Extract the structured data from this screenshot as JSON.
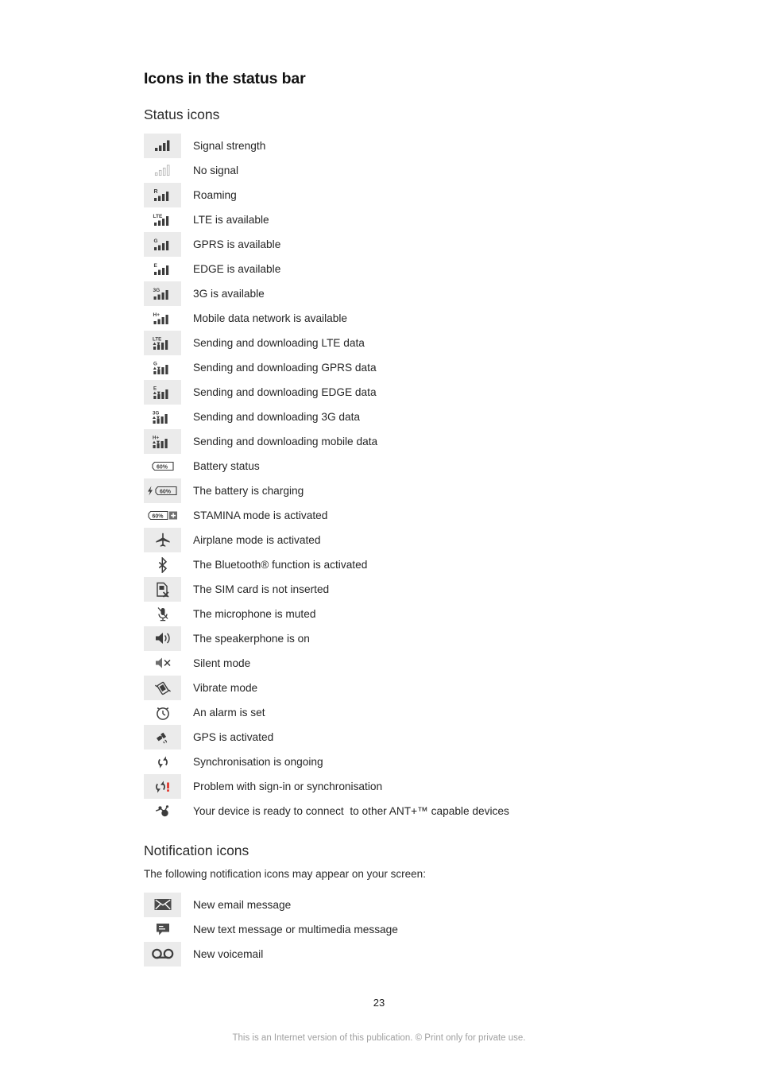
{
  "document": {
    "chapter_title": "Icons in the status bar",
    "page_number": "23",
    "footer_note": "This is an Internet version of this publication. © Print only for private use."
  },
  "status_section": {
    "heading": "Status icons",
    "rows": [
      {
        "icon": "signal-strength-icon",
        "label": "Signal strength"
      },
      {
        "icon": "no-signal-icon",
        "label": "No signal"
      },
      {
        "icon": "roaming-icon",
        "label": "Roaming"
      },
      {
        "icon": "lte-available-icon",
        "label": "LTE is available"
      },
      {
        "icon": "gprs-available-icon",
        "label": "GPRS is available"
      },
      {
        "icon": "edge-available-icon",
        "label": "EDGE is available"
      },
      {
        "icon": "3g-available-icon",
        "label": "3G is available"
      },
      {
        "icon": "mobile-data-available-icon",
        "label": "Mobile data network is available"
      },
      {
        "icon": "lte-data-transfer-icon",
        "label": "Sending and downloading LTE data"
      },
      {
        "icon": "gprs-data-transfer-icon",
        "label": "Sending and downloading GPRS data"
      },
      {
        "icon": "edge-data-transfer-icon",
        "label": "Sending and downloading EDGE data"
      },
      {
        "icon": "3g-data-transfer-icon",
        "label": "Sending and downloading 3G data"
      },
      {
        "icon": "mobile-data-transfer-icon",
        "label": "Sending and downloading mobile data"
      },
      {
        "icon": "battery-status-icon",
        "label": "Battery status"
      },
      {
        "icon": "battery-charging-icon",
        "label": "The battery is charging"
      },
      {
        "icon": "stamina-mode-icon",
        "label": "STAMINA mode is activated"
      },
      {
        "icon": "airplane-mode-icon",
        "label": "Airplane mode is activated"
      },
      {
        "icon": "bluetooth-icon",
        "label": "The Bluetooth® function is activated"
      },
      {
        "icon": "sim-card-missing-icon",
        "label": "The SIM card is not inserted"
      },
      {
        "icon": "microphone-muted-icon",
        "label": "The microphone is muted"
      },
      {
        "icon": "speakerphone-icon",
        "label": "The speakerphone is on"
      },
      {
        "icon": "silent-mode-icon",
        "label": "Silent mode"
      },
      {
        "icon": "vibrate-mode-icon",
        "label": "Vibrate mode"
      },
      {
        "icon": "alarm-icon",
        "label": "An alarm is set"
      },
      {
        "icon": "gps-icon",
        "label": "GPS is activated"
      },
      {
        "icon": "sync-ongoing-icon",
        "label": "Synchronisation is ongoing"
      },
      {
        "icon": "sync-problem-icon",
        "label": "Problem with sign-in or synchronisation"
      },
      {
        "icon": "ant-plus-icon",
        "label": "Your device is ready to connect  to other ANT+™ capable devices"
      }
    ]
  },
  "notification_section": {
    "heading": "Notification icons",
    "intro": "The following notification icons may appear on your screen:",
    "rows": [
      {
        "icon": "new-email-icon",
        "label": "New email message"
      },
      {
        "icon": "new-text-message-icon",
        "label": "New text message or multimedia message"
      },
      {
        "icon": "new-voicemail-icon",
        "label": "New voicemail"
      }
    ]
  },
  "battery": {
    "level_text": "60%"
  },
  "network_labels": {
    "lte": "LTE",
    "gprs": "G",
    "edge": "E",
    "threeg": "3G",
    "hplus": "H+"
  },
  "colors": {
    "icon_dark": "#3c3c3c",
    "icon_light": "#b4b4b4",
    "cell_shade": "#ebebeb",
    "text": "#262626",
    "alert_red": "#e02b20"
  }
}
